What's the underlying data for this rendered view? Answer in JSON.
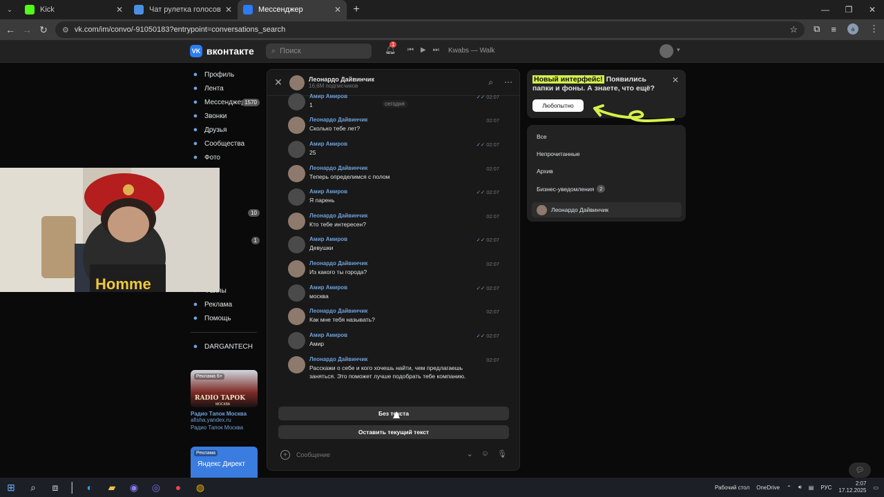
{
  "browser": {
    "tabs": [
      {
        "title": "Kick",
        "fav_color": "#53fc18"
      },
      {
        "title": "Чат рулетка голосовая — Nek",
        "fav_color": "#4a90e2"
      },
      {
        "title": "Мессенджер",
        "fav_color": "#2b7cf6"
      }
    ],
    "url": "vk.com/im/convo/-91050183?entrypoint=conversations_search",
    "profile_initial": "a"
  },
  "vk": {
    "logo_text": "вконтакте",
    "logo_mark": "VK",
    "search_placeholder": "Поиск",
    "notif_count": "1",
    "track": "Kwabs — Walk"
  },
  "nav": {
    "items": [
      {
        "label": "Профиль",
        "icon": "profile-icon",
        "count": ""
      },
      {
        "label": "Лента",
        "icon": "news-icon",
        "count": ""
      },
      {
        "label": "Мессенджер",
        "icon": "messenger-icon",
        "count": "1570"
      },
      {
        "label": "Звонки",
        "icon": "phone-icon",
        "count": ""
      },
      {
        "label": "Друзья",
        "icon": "friends-icon",
        "count": ""
      },
      {
        "label": "Сообщества",
        "icon": "communities-icon",
        "count": ""
      },
      {
        "label": "Фото",
        "icon": "photo-icon",
        "count": ""
      },
      {
        "label": "ка",
        "icon": "music-icon",
        "count": ""
      },
      {
        "label": "о",
        "icon": "video-icon",
        "count": ""
      },
      {
        "label": "ы",
        "icon": "games-icon",
        "count": ""
      },
      {
        "label": "",
        "icon": "apps-icon",
        "count": "10"
      },
      {
        "label": "еры",
        "icon": "stickers-icon",
        "count": ""
      },
      {
        "label": "ет",
        "icon": "market-icon",
        "count": "1"
      }
    ],
    "items2": [
      {
        "label": "исы",
        "icon": "services-icon"
      },
      {
        "label": "а",
        "icon": "vk-pay-icon"
      },
      {
        "label": "Файлы",
        "icon": "files-icon"
      },
      {
        "label": "Реклама",
        "icon": "ads-icon"
      },
      {
        "label": "Помощь",
        "icon": "help-icon"
      }
    ],
    "group_label": "DARGANTECH"
  },
  "ads": [
    {
      "tag": "Реклама 6+",
      "banner": "RADIO TAPOK",
      "banner_sub": "МОСКВА",
      "title": "Радио Тапок Москва",
      "domain": "afisha.yandex.ru",
      "subtitle": "Радио Тапок Москва"
    },
    {
      "tag": "Реклама",
      "banner": "Яндекс Директ",
      "title": "",
      "domain": "",
      "subtitle": ""
    }
  ],
  "chat": {
    "name": "Леонардо Дайвинчик",
    "subscribers": "16,6M подписчиков",
    "day_label": "сегодня",
    "messages": [
      {
        "author": "Амир Амиров",
        "text": "1",
        "time": "02:07",
        "self": true
      },
      {
        "author": "Леонардо Дайвинчик",
        "text": "Сколько тебе лет?",
        "time": "02:07",
        "self": false
      },
      {
        "author": "Амир Амиров",
        "text": "25",
        "time": "02:07",
        "self": true
      },
      {
        "author": "Леонардо Дайвинчик",
        "text": "Теперь определимся с полом",
        "time": "02:07",
        "self": false
      },
      {
        "author": "Амир Амиров",
        "text": "Я парень",
        "time": "02:07",
        "self": true
      },
      {
        "author": "Леонардо Дайвинчик",
        "text": "Кто тебе интересен?",
        "time": "02:07",
        "self": false
      },
      {
        "author": "Амир Амиров",
        "text": "Девушки",
        "time": "02:07",
        "self": true
      },
      {
        "author": "Леонардо Дайвинчик",
        "text": "Из какого ты города?",
        "time": "02:07",
        "self": false
      },
      {
        "author": "Амир Амиров",
        "text": "москва",
        "time": "02:07",
        "self": true
      },
      {
        "author": "Леонардо Дайвинчик",
        "text": "Как мне тебя называть?",
        "time": "02:07",
        "self": false
      },
      {
        "author": "Амир Амиров",
        "text": "Амир",
        "time": "02:07",
        "self": true
      },
      {
        "author": "Леонардо Дайвинчик",
        "text": "Расскажи о себе и кого хочешь найти, чем предлагаешь заняться. Это поможет лучше подобрать тебе компанию.",
        "time": "02:07",
        "self": false
      }
    ],
    "quick_reply_1": "Без текста",
    "quick_reply_2": "Оставить текущий текст",
    "composer_placeholder": "Сообщение"
  },
  "promo": {
    "highlight": "Новый интерфейс!",
    "text": " Появились папки и фоны. А знаете, что ещё?",
    "button": "Любопытно"
  },
  "folders": {
    "items": [
      {
        "label": "Все",
        "count": ""
      },
      {
        "label": "Непрочитанные",
        "count": ""
      },
      {
        "label": "Архив",
        "count": ""
      },
      {
        "label": "Бизнес-уведомления",
        "count": "2"
      }
    ],
    "selected": "Леонардо Дайвинчик"
  },
  "taskbar": {
    "desktop_label": "Рабочий стол",
    "onedrive": "OneDrive",
    "lang": "РУС",
    "time": "2:07",
    "date": "17.12.2025"
  },
  "colors": {
    "accent": "#6fa1dc",
    "highlight": "#d6f04b",
    "vk_blue": "#2b7cf6"
  }
}
